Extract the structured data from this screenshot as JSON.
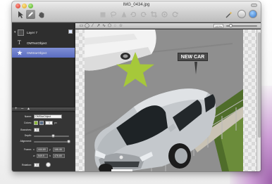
{
  "window": {
    "title": "IMG_0434.jpg"
  },
  "layers": [
    {
      "label": "Layer 7"
    },
    {
      "label": "OMTextObject"
    },
    {
      "label": "OMStarObject"
    }
  ],
  "inspector": {
    "name_label": "Name:",
    "name_value": "OMStarObject",
    "colors_label": "Colors:",
    "colors_value": "1",
    "colors_unit": "px",
    "fill_color": "#8db83c",
    "stroke_color": "#5a6e8a",
    "branches_label": "Branches:",
    "branches_value": "5",
    "depth_label": "Depth:",
    "alignment_label": "Alignment:",
    "frame_label": "Frame:",
    "frame_x_label": "x",
    "frame_x": "444.69",
    "frame_y_label": "y",
    "frame_y": "166.46",
    "frame_w_label": "w",
    "frame_w": "549.9",
    "frame_h_label": "h",
    "frame_h": "476.65",
    "rotation_label": "Rotation:",
    "rotation_value": "0"
  },
  "canvas": {
    "zoom": "100%",
    "text_object": "NEW CAR",
    "star_color": "#a6c83a"
  },
  "icons": {
    "tools": [
      "arrow-icon",
      "pen-icon",
      "hand-icon"
    ],
    "actions": [
      "rectangle-icon",
      "lasso-icon",
      "shape-icon",
      "rotate-icon",
      "rotate-icon",
      "crop-icon",
      "effects-icon",
      "refresh-icon"
    ],
    "right": [
      "magic-wand-icon",
      "info-icon",
      "globe-icon"
    ]
  }
}
